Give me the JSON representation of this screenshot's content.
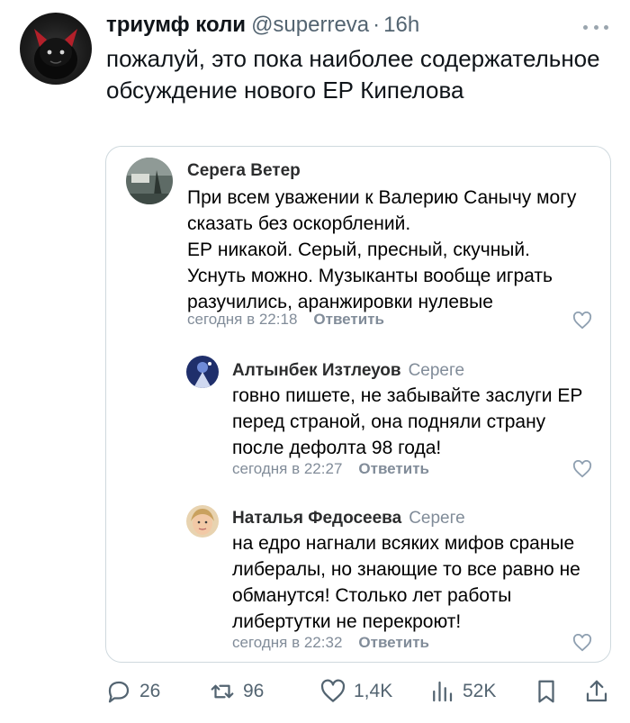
{
  "tweet": {
    "author": {
      "display_name": "триумф коли",
      "handle": "@superreva",
      "separator": "·",
      "time": "16h"
    },
    "text": "пожалуй, это пока наиболее содержательное обсуждение нового ЕР Кипелова"
  },
  "comments": [
    {
      "name": "Серега Ветер",
      "reply_to": "",
      "text": "При всем уважении к Валерию Санычу могу сказать без оскорблений.\nЕР никакой. Серый, пресный, скучный. Уснуть можно. Музыканты вообще играть разучились, аранжировки нулевые",
      "time": "сегодня в 22:18",
      "reply_label": "Ответить"
    },
    {
      "name": "Алтынбек Изтлеуов",
      "reply_to": "Сереге",
      "text": "говно пишете, не забывайте заслуги ЕР перед страной, она подняли страну после дефолта 98 года!",
      "time": "сегодня в 22:27",
      "reply_label": "Ответить"
    },
    {
      "name": "Наталья Федосеева",
      "reply_to": "Сереге",
      "text": "на едро нагнали всяких мифов сраные либералы, но знающие то все равно не обманутся! Столько лет работы либертутки не перекроют!",
      "time": "сегодня в 22:32",
      "reply_label": "Ответить"
    }
  ],
  "actions": {
    "replies": "26",
    "reposts": "96",
    "likes": "1,4K",
    "views": "52K"
  },
  "colors": {
    "text": "#0f1419",
    "secondary": "#536471",
    "vk_meta": "#818c99",
    "border": "#cfd9de"
  },
  "icons": [
    "reply-icon",
    "repost-icon",
    "like-icon",
    "views-icon",
    "bookmark-icon",
    "share-icon",
    "heart-outline-icon",
    "more-icon"
  ]
}
